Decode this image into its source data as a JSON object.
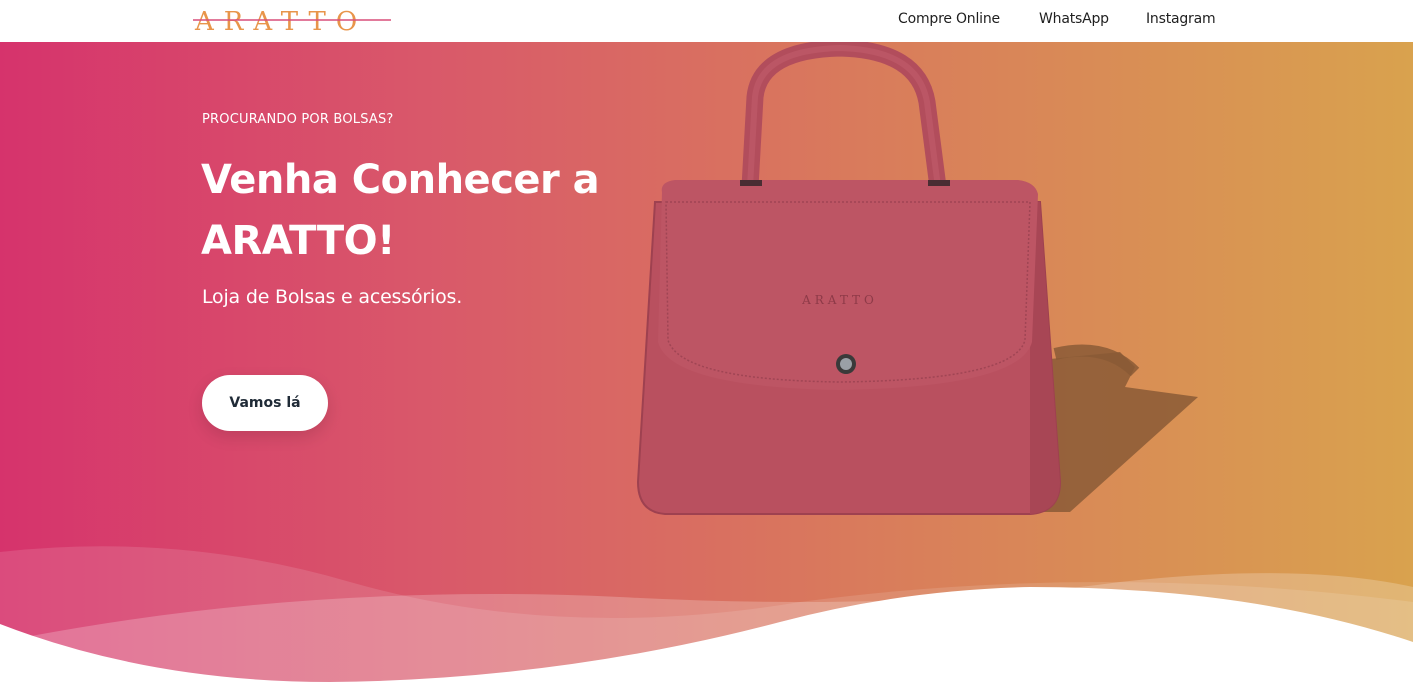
{
  "header": {
    "logo_text": "ARATTO",
    "nav": [
      {
        "label": "Compre Online"
      },
      {
        "label": "WhatsApp"
      },
      {
        "label": "Instagram"
      }
    ]
  },
  "hero": {
    "eyebrow": "PROCURANDO POR BOLSAS?",
    "title": "Venha Conhecer a ARATTO!",
    "subtitle": "Loja de Bolsas e acessórios.",
    "cta_label": "Vamos lá",
    "bag_brand_text": "ARATTO"
  },
  "colors": {
    "gradient_start": "#d6336c",
    "gradient_end": "#d9a24e",
    "logo_orange": "#e8954a",
    "logo_pink": "#d94f7a",
    "bag": "#b9505f"
  }
}
